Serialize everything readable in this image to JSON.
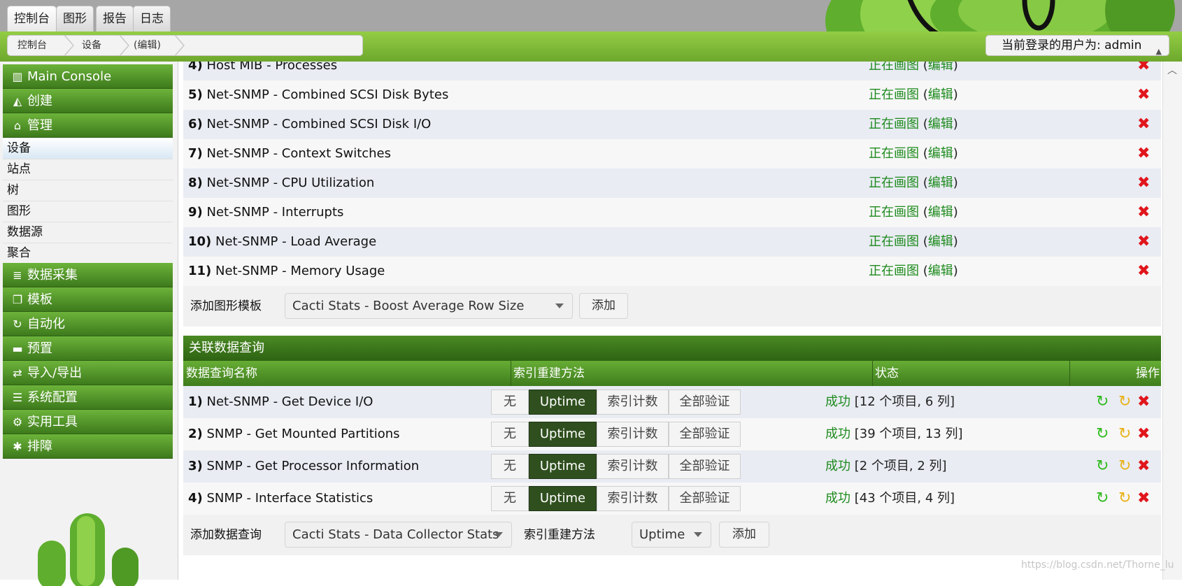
{
  "top_tabs": [
    "控制台",
    "图形",
    "报告",
    "日志"
  ],
  "breadcrumb": [
    "控制台",
    "设备",
    "(编辑)"
  ],
  "user_label": "当前登录的用户为: admin",
  "sidebar": {
    "heads_top": [
      {
        "label": "Main Console",
        "icon": "map-icon"
      },
      {
        "label": "创建",
        "icon": "chart-area-icon"
      },
      {
        "label": "管理",
        "icon": "home-icon"
      }
    ],
    "sub_items": [
      "设备",
      "站点",
      "树",
      "图形",
      "数据源",
      "聚合"
    ],
    "heads_bottom": [
      {
        "label": "数据采集",
        "icon": "database-icon"
      },
      {
        "label": "模板",
        "icon": "clone-icon"
      },
      {
        "label": "自动化",
        "icon": "refresh-icon"
      },
      {
        "label": "预置",
        "icon": "archive-icon"
      },
      {
        "label": "导入/导出",
        "icon": "exchange-icon"
      },
      {
        "label": "系统配置",
        "icon": "sliders-icon"
      },
      {
        "label": "实用工具",
        "icon": "cogs-icon"
      },
      {
        "label": "排障",
        "icon": "bug-icon"
      }
    ]
  },
  "graph_templates": {
    "status_text": "正在画图",
    "edit_text": "编辑",
    "rows": [
      {
        "num": "4)",
        "name": "Host MIB - Processes"
      },
      {
        "num": "5)",
        "name": "Net-SNMP - Combined SCSI Disk Bytes"
      },
      {
        "num": "6)",
        "name": "Net-SNMP - Combined SCSI Disk I/O"
      },
      {
        "num": "7)",
        "name": "Net-SNMP - Context Switches"
      },
      {
        "num": "8)",
        "name": "Net-SNMP - CPU Utilization"
      },
      {
        "num": "9)",
        "name": "Net-SNMP - Interrupts"
      },
      {
        "num": "10)",
        "name": "Net-SNMP - Load Average"
      },
      {
        "num": "11)",
        "name": "Net-SNMP - Memory Usage"
      }
    ],
    "add_label": "添加图形模板",
    "add_select": "Cacti Stats - Boost Average Row Size",
    "add_button": "添加"
  },
  "data_queries": {
    "section_title": "关联数据查询",
    "columns": [
      "数据查询名称",
      "索引重建方法",
      "状态",
      "操作"
    ],
    "reindex_options": [
      "无",
      "Uptime",
      "索引计数",
      "全部验证"
    ],
    "selected_option": "Uptime",
    "status_ok": "成功",
    "rows": [
      {
        "num": "1)",
        "name": "Net-SNMP - Get Device I/O",
        "status_detail": "[12 个项目, 6 列]"
      },
      {
        "num": "2)",
        "name": "SNMP - Get Mounted Partitions",
        "status_detail": "[39 个项目, 13 列]"
      },
      {
        "num": "3)",
        "name": "SNMP - Get Processor Information",
        "status_detail": "[2 个项目, 2 列]"
      },
      {
        "num": "4)",
        "name": "SNMP - Interface Statistics",
        "status_detail": "[43 个项目, 4 列]"
      }
    ],
    "add_label": "添加数据查询",
    "add_select": "Cacti Stats - Data Collector Stats",
    "reindex_label": "索引重建方法",
    "reindex_select": "Uptime",
    "add_button": "添加"
  },
  "watermark": "https://blog.csdn.net/Thorne_lu",
  "colors": {
    "green_dark": "#2e6312",
    "green_light": "#8dc63f",
    "delete_red": "#e0161c",
    "ok_green": "#1d8a1d"
  }
}
